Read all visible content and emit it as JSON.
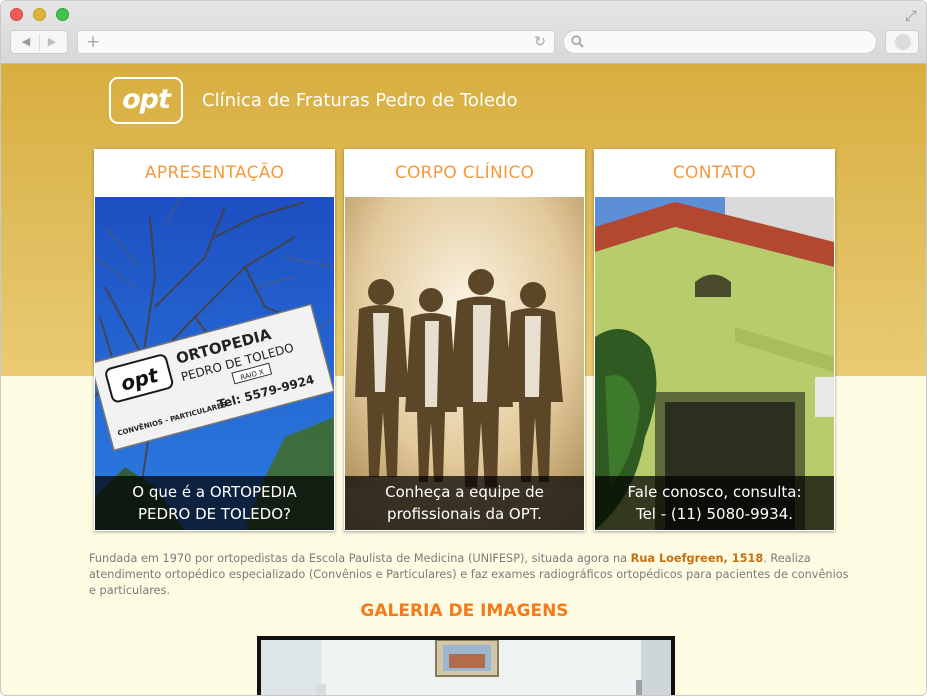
{
  "site": {
    "logo_text": "opt",
    "title": "Clínica de Fraturas Pedro de Toledo"
  },
  "cards": [
    {
      "heading": "APRESENTAÇÃO",
      "caption_line1": "O que é a ORTOPEDIA",
      "caption_line2": "PEDRO DE TOLEDO?",
      "sign_brand": "opt",
      "sign_line1": "ORTOPEDIA",
      "sign_line2": "PEDRO DE TOLEDO",
      "sign_raio": "RAIO X",
      "sign_conv": "CONVÊNIOS - PARTICULARES",
      "sign_tel": "Tel: 5579-9924"
    },
    {
      "heading": "CORPO CLÍNICO",
      "caption_line1": "Conheça a equipe de",
      "caption_line2": "profissionais da OPT."
    },
    {
      "heading": "CONTATO",
      "caption_line1": "Fale conosco, consulta:",
      "caption_line2": "Tel - (11) 5080-9934."
    }
  ],
  "intro": {
    "text_before": "Fundada em 1970 por ortopedistas da Escola Paulista de Medicina (UNIFESP), situada agora na ",
    "address_link": "Rua Loefgreen, 1518",
    "text_after": ". Realiza atendimento ortopédico especializado (Convênios e Particulares) e faz exames radiográficos ortopédicos para pacientes de convênios e particulares."
  },
  "gallery": {
    "title": "GALERIA DE IMAGENS"
  },
  "icons": {
    "back": "back-arrow-icon",
    "forward": "forward-arrow-icon",
    "new_tab": "plus-icon",
    "reload": "reload-icon",
    "search": "search-icon",
    "expand": "expand-icon"
  },
  "colors": {
    "header_gold": "#d8ae3e",
    "card_heading": "#f39a3c",
    "gallery_title": "#f47a1c",
    "link": "#c7700f",
    "page_bg": "#fefbe3"
  }
}
